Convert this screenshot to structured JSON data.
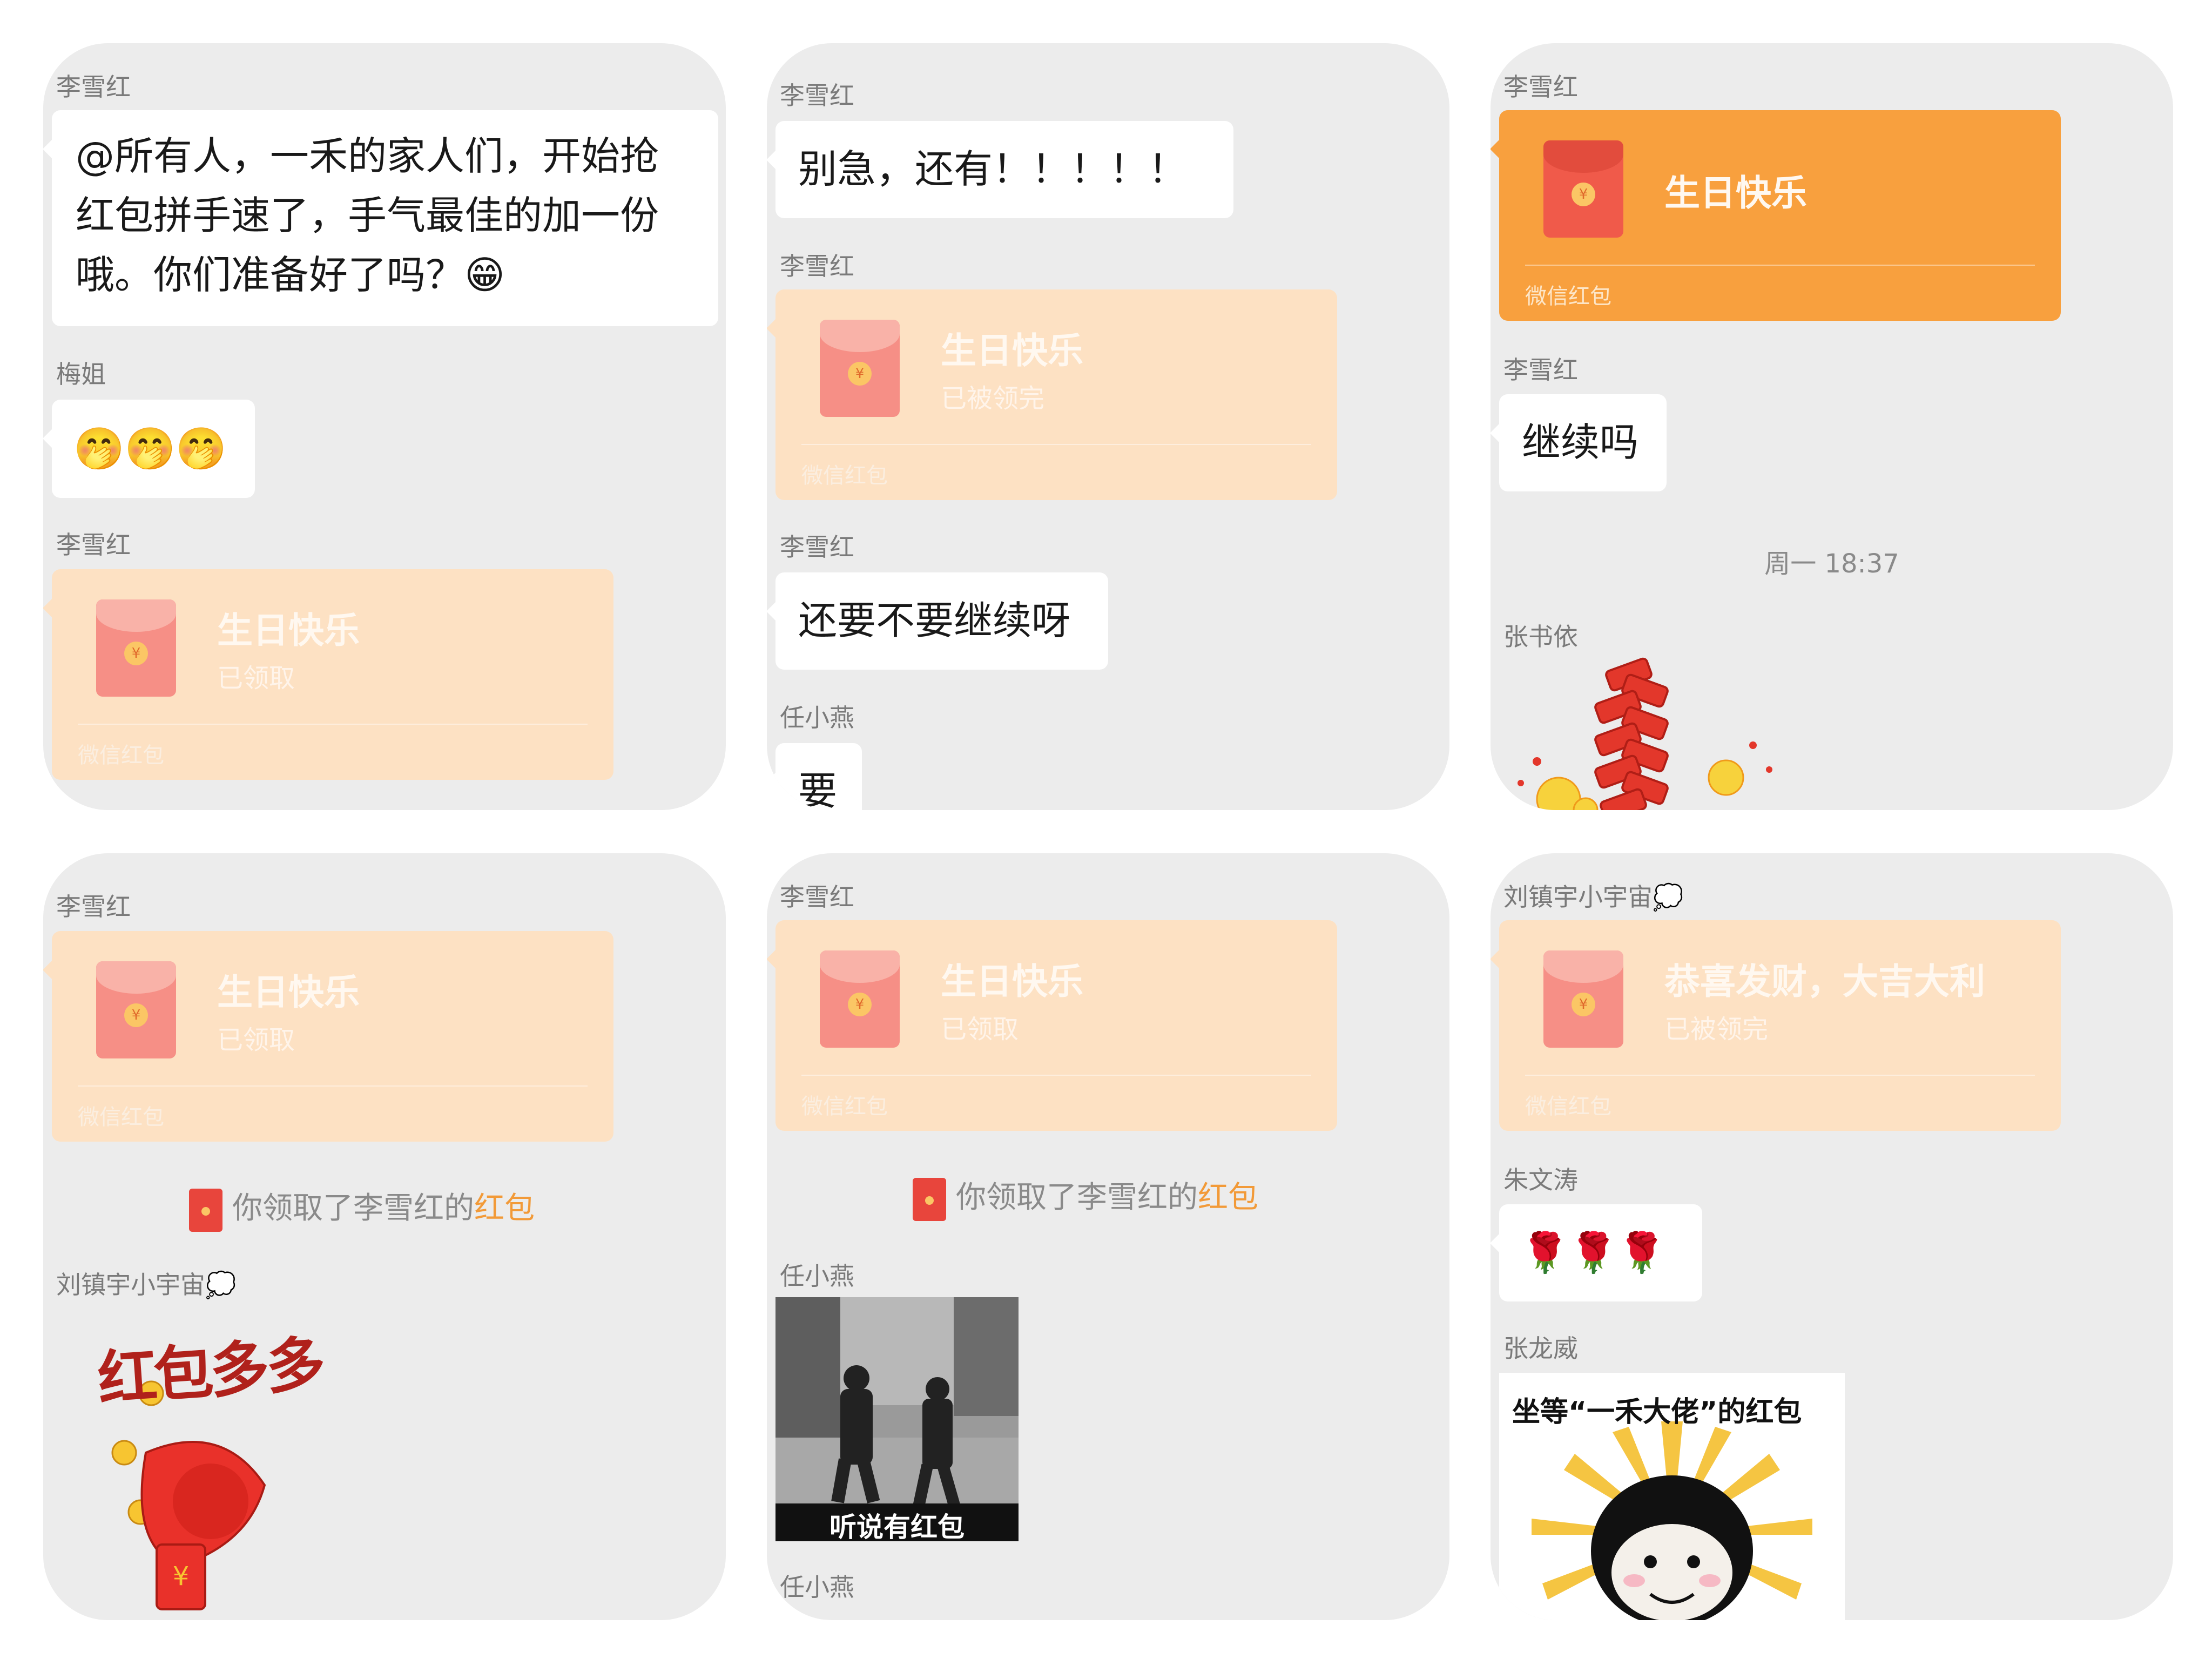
{
  "panels": {
    "p1": {
      "m1_sender": "李雪红",
      "m1_text": "@所有人，一禾的家人们，开始抢红包拼手速了，手气最佳的加一份哦。你们准备好了吗？😁",
      "m2_sender": "梅姐",
      "m2_text": "🤭🤭🤭",
      "m3_sender": "李雪红",
      "rp_title": "生日快乐",
      "rp_status": "已领取",
      "rp_foot": "微信红包"
    },
    "p2": {
      "m1_sender": "李雪红",
      "m1_text": "别急，还有！！！！！",
      "m2_sender": "李雪红",
      "rp_title": "生日快乐",
      "rp_status": "已被领完",
      "rp_foot": "微信红包",
      "m3_sender": "李雪红",
      "m3_text": "还要不要继续呀",
      "m4_sender": "任小燕",
      "m4_text": "要"
    },
    "p3": {
      "m1_sender": "李雪红",
      "rp_title": "生日快乐",
      "rp_foot": "微信红包",
      "m2_sender": "李雪红",
      "m2_text": "继续吗",
      "time": "周一 18:37",
      "m3_sender": "张书依",
      "m3_sticker": "firecracker-sticker"
    },
    "p4": {
      "m1_sender": "李雪红",
      "rp_title": "生日快乐",
      "rp_status": "已领取",
      "rp_foot": "微信红包",
      "sys_prefix": "你领取了李雪红的",
      "sys_highlight": "红包",
      "m2_sender": "刘镇宇小宇宙💭",
      "sticker_text": "红包多多"
    },
    "p5": {
      "m1_sender": "李雪红",
      "rp_title": "生日快乐",
      "rp_status": "已领取",
      "rp_foot": "微信红包",
      "sys_prefix": "你领取了李雪红的",
      "sys_highlight": "红包",
      "m2_sender": "任小燕",
      "photo_caption": "听说有红包",
      "m3_sender": "任小燕"
    },
    "p6": {
      "m1_sender": "刘镇宇小宇宙💭",
      "rp_title": "恭喜发财，大吉大利",
      "rp_status": "已被领完",
      "rp_foot": "微信红包",
      "m2_sender": "朱文涛",
      "m2_text": "🌹🌹🌹",
      "m3_sender": "张龙威",
      "sticker_text": "坐等“一禾大佬”的红包"
    }
  },
  "colors": {
    "panel_bg": "#ececec",
    "redpacket_claimed": "#fde1c3",
    "redpacket_active": "#f8a03e",
    "highlight": "#f29a38"
  }
}
